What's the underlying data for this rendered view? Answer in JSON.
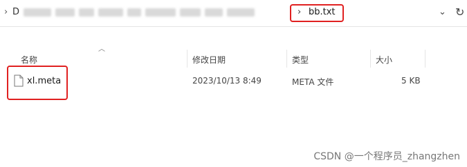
{
  "address_bar": {
    "path_first_char": "D",
    "current_folder": "bb.txt"
  },
  "columns": {
    "name": "名称",
    "date": "修改日期",
    "type": "类型",
    "size": "大小"
  },
  "files": [
    {
      "name": "xl.meta",
      "date": "2023/10/13 8:49",
      "type": "META 文件",
      "size": "5 KB",
      "icon": "file-icon"
    }
  ],
  "watermark": "CSDN @一个程序员_zhangzhen",
  "colors": {
    "highlight": "#e02020"
  }
}
